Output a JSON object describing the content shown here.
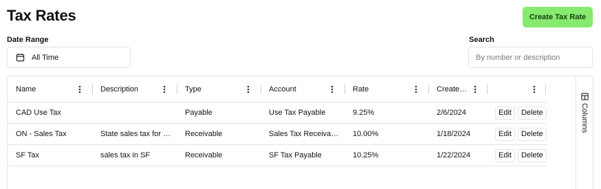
{
  "page": {
    "title": "Tax Rates",
    "create_label": "Create Tax Rate"
  },
  "filters": {
    "date_label": "Date Range",
    "date_value": "All Time",
    "search_label": "Search",
    "search_placeholder": "By number or description"
  },
  "table": {
    "headers": [
      "Name",
      "Description",
      "Type",
      "Account",
      "Rate",
      "Create…",
      ""
    ],
    "rows": [
      {
        "name": "CAD Use Tax",
        "description": "",
        "type": "Payable",
        "account": "Use Tax Payable",
        "rate": "9.25%",
        "created": "2/6/2024"
      },
      {
        "name": "ON - Sales Tax",
        "description": "State sales tax for …",
        "type": "Receivable",
        "account": "Sales Tax Receiva…",
        "rate": "10.00%",
        "created": "1/18/2024"
      },
      {
        "name": "SF Tax",
        "description": "sales tax in SF",
        "type": "Receivable",
        "account": "SF Tax Payable",
        "rate": "10.25%",
        "created": "1/22/2024"
      }
    ],
    "edit_label": "Edit",
    "delete_label": "Delete"
  },
  "side_panel": {
    "columns_label": "Columns"
  },
  "colors": {
    "accent": "#86ea6e",
    "border": "#e3e3e3"
  }
}
